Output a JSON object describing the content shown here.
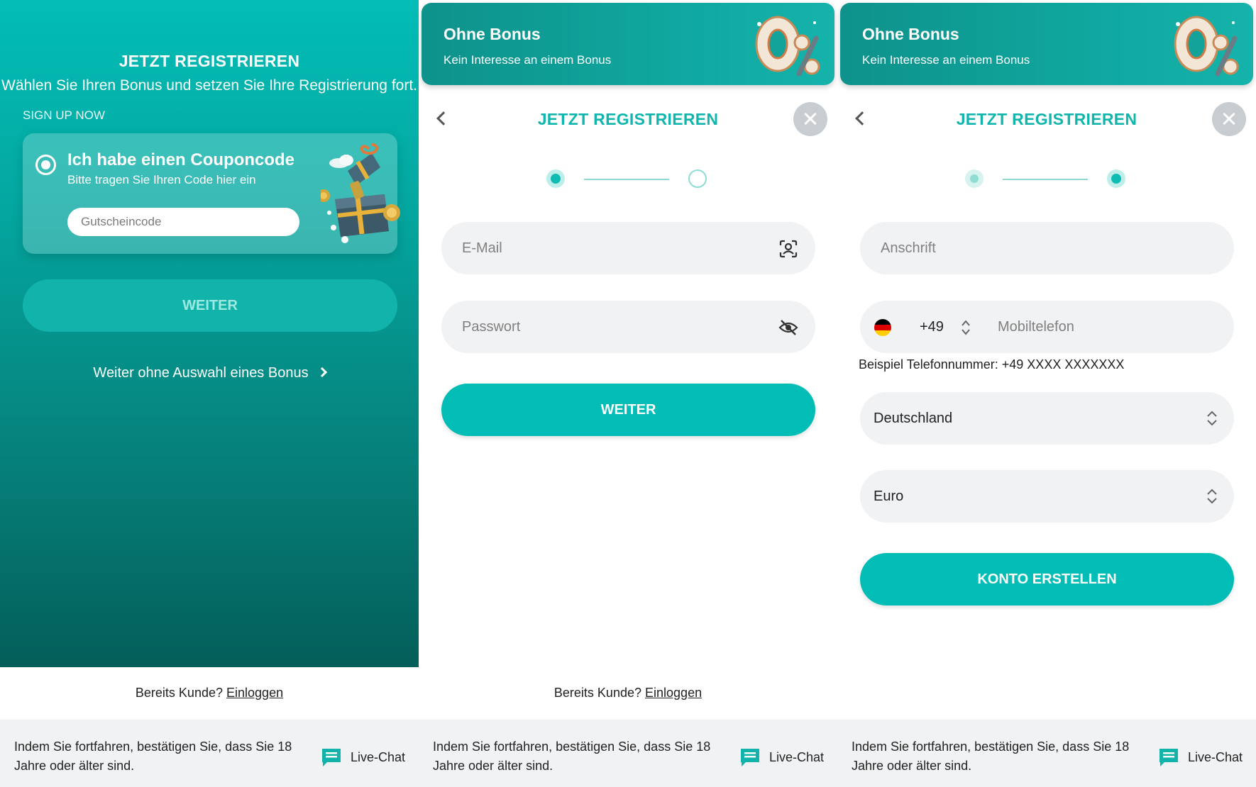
{
  "panel1": {
    "title": "JETZT REGISTRIEREN",
    "subtitle": "Wählen Sie Ihren Bonus und setzen Sie Ihre Registrierung fort.",
    "signup": "SIGN UP NOW",
    "coupon": {
      "title": "Ich habe einen Couponcode",
      "desc": "Bitte tragen Sie Ihren Code hier ein",
      "placeholder": "Gutscheincode"
    },
    "button": "WEITER",
    "no_bonus_link": "Weiter ohne Auswahl eines Bonus"
  },
  "banner": {
    "title": "Ohne Bonus",
    "subtitle": "Kein Interesse an einem Bonus"
  },
  "register_title": "JETZT REGISTRIEREN",
  "panel2": {
    "email_placeholder": "E-Mail",
    "password_placeholder": "Passwort",
    "button": "WEITER"
  },
  "panel3": {
    "address_placeholder": "Anschrift",
    "dial_code": "+49",
    "phone_placeholder": "Mobiltelefon",
    "phone_hint": "Beispiel Telefonnummer: +49 XXXX XXXXXXX",
    "country": "Deutschland",
    "currency": "Euro",
    "button": "KONTO ERSTELLEN"
  },
  "already": {
    "text": "Bereits Kunde?",
    "link": "Einloggen"
  },
  "footer": {
    "text": "Indem Sie fortfahren, bestätigen Sie, dass Sie 18 Jahre oder älter sind.",
    "chat": "Live-Chat"
  },
  "colors": {
    "accent": "#02bdb6",
    "teal_dark": "#045e59",
    "field_bg": "#f1f2f4",
    "footer_bg": "#f1f2f4"
  },
  "icons": [
    "radio-icon",
    "gift-box-icon",
    "chevron-right-icon",
    "zero-percent-icon",
    "back-chevron-icon",
    "close-icon",
    "face-id-icon",
    "eye-off-icon",
    "germany-flag-icon",
    "updown-chevron-icon",
    "chat-icon"
  ]
}
